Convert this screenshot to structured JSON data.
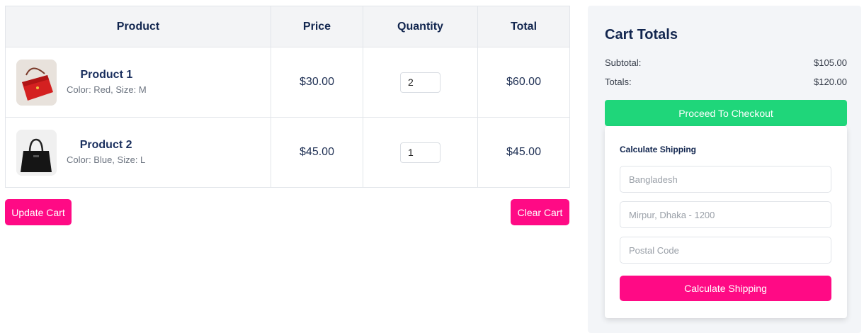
{
  "cart": {
    "columns": [
      "Product",
      "Price",
      "Quantity",
      "Total"
    ],
    "items": [
      {
        "name": "Product 1",
        "variant": "Color: Red, Size: M",
        "price": "$30.00",
        "quantity": "2",
        "total": "$60.00",
        "image_icon": "red-handbag-image"
      },
      {
        "name": "Product 2",
        "variant": "Color: Blue, Size: L",
        "price": "$45.00",
        "quantity": "1",
        "total": "$45.00",
        "image_icon": "black-handbag-image"
      }
    ],
    "update_label": "Update Cart",
    "clear_label": "Clear Cart"
  },
  "totals": {
    "title": "Cart Totals",
    "subtotal_label": "Subtotal:",
    "subtotal_value": "$105.00",
    "totals_label": "Totals:",
    "totals_value": "$120.00",
    "checkout_label": "Proceed To Checkout"
  },
  "shipping": {
    "title": "Calculate Shipping",
    "country_placeholder": "Bangladesh",
    "address_placeholder": "Mirpur, Dhaka - 1200",
    "postal_placeholder": "Postal Code",
    "button_label": "Calculate Shipping"
  },
  "colors": {
    "accent_pink": "#ff0a85",
    "checkout_green": "#1fd67a",
    "heading_navy": "#12264f"
  }
}
